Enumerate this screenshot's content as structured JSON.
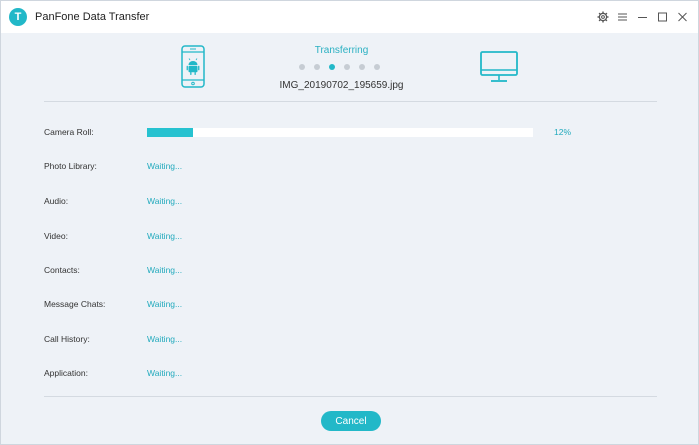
{
  "app": {
    "title": "PanFone Data Transfer",
    "logo_letter": "T",
    "accent_color": "#22b8c8"
  },
  "title_controls": [
    {
      "icon": "gear-icon"
    },
    {
      "icon": "menu-icon"
    },
    {
      "icon": "minimize-icon"
    },
    {
      "icon": "maximize-icon"
    },
    {
      "icon": "close-icon"
    }
  ],
  "transfer": {
    "status": "Transferring",
    "current_file": "IMG_20190702_195659.jpg",
    "step_total": 6,
    "step_active": 3,
    "source_icon": "android-phone-icon",
    "target_icon": "computer-monitor-icon"
  },
  "categories": [
    {
      "label": "Camera Roll:",
      "status": "",
      "progress": 12,
      "progress_text": "12%"
    },
    {
      "label": "Photo Library:",
      "status": "Waiting..."
    },
    {
      "label": "Audio:",
      "status": "Waiting..."
    },
    {
      "label": "Video:",
      "status": "Waiting..."
    },
    {
      "label": "Contacts:",
      "status": "Waiting..."
    },
    {
      "label": "Message Chats:",
      "status": "Waiting..."
    },
    {
      "label": "Call History:",
      "status": "Waiting..."
    },
    {
      "label": "Application:",
      "status": "Waiting..."
    }
  ],
  "cancel_label": "Cancel"
}
